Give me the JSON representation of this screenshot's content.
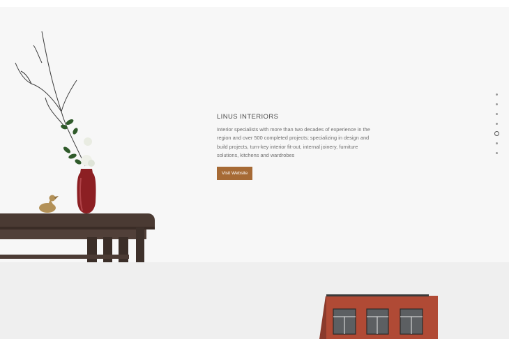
{
  "section": {
    "title": "LINUS INTERIORS",
    "description": "Interior specialists with more than two decades of experience in the region and over 500 completed projects; specializing in design and build projects, turn-key interior fit-out, internal joinery, furniture solutions, kitchens and wardrobes",
    "button_label": "Visit Website"
  },
  "pager": {
    "count": 7,
    "active_index": 4
  },
  "colors": {
    "accent": "#a66a35",
    "hero_bg": "#f7f7f7",
    "next_bg": "#efefef",
    "brick": "#b24a36"
  }
}
